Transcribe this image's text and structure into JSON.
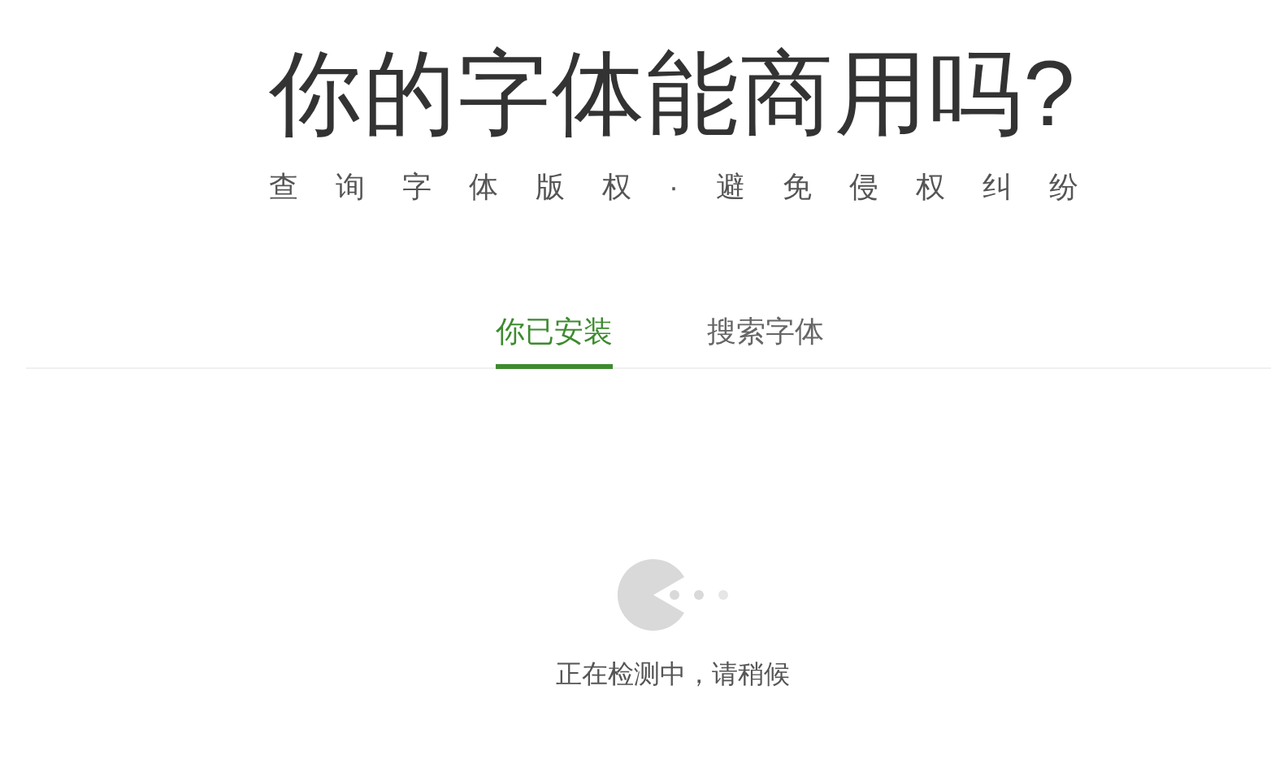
{
  "title": "你的字体能商用吗?",
  "subtitle": "查询字体版权·避免侵权纠纷",
  "tabs": [
    {
      "label": "你已安装",
      "selected": true
    },
    {
      "label": "搜索字体",
      "selected": false
    }
  ],
  "loading": {
    "message": "正在检测中，请稍候"
  }
}
